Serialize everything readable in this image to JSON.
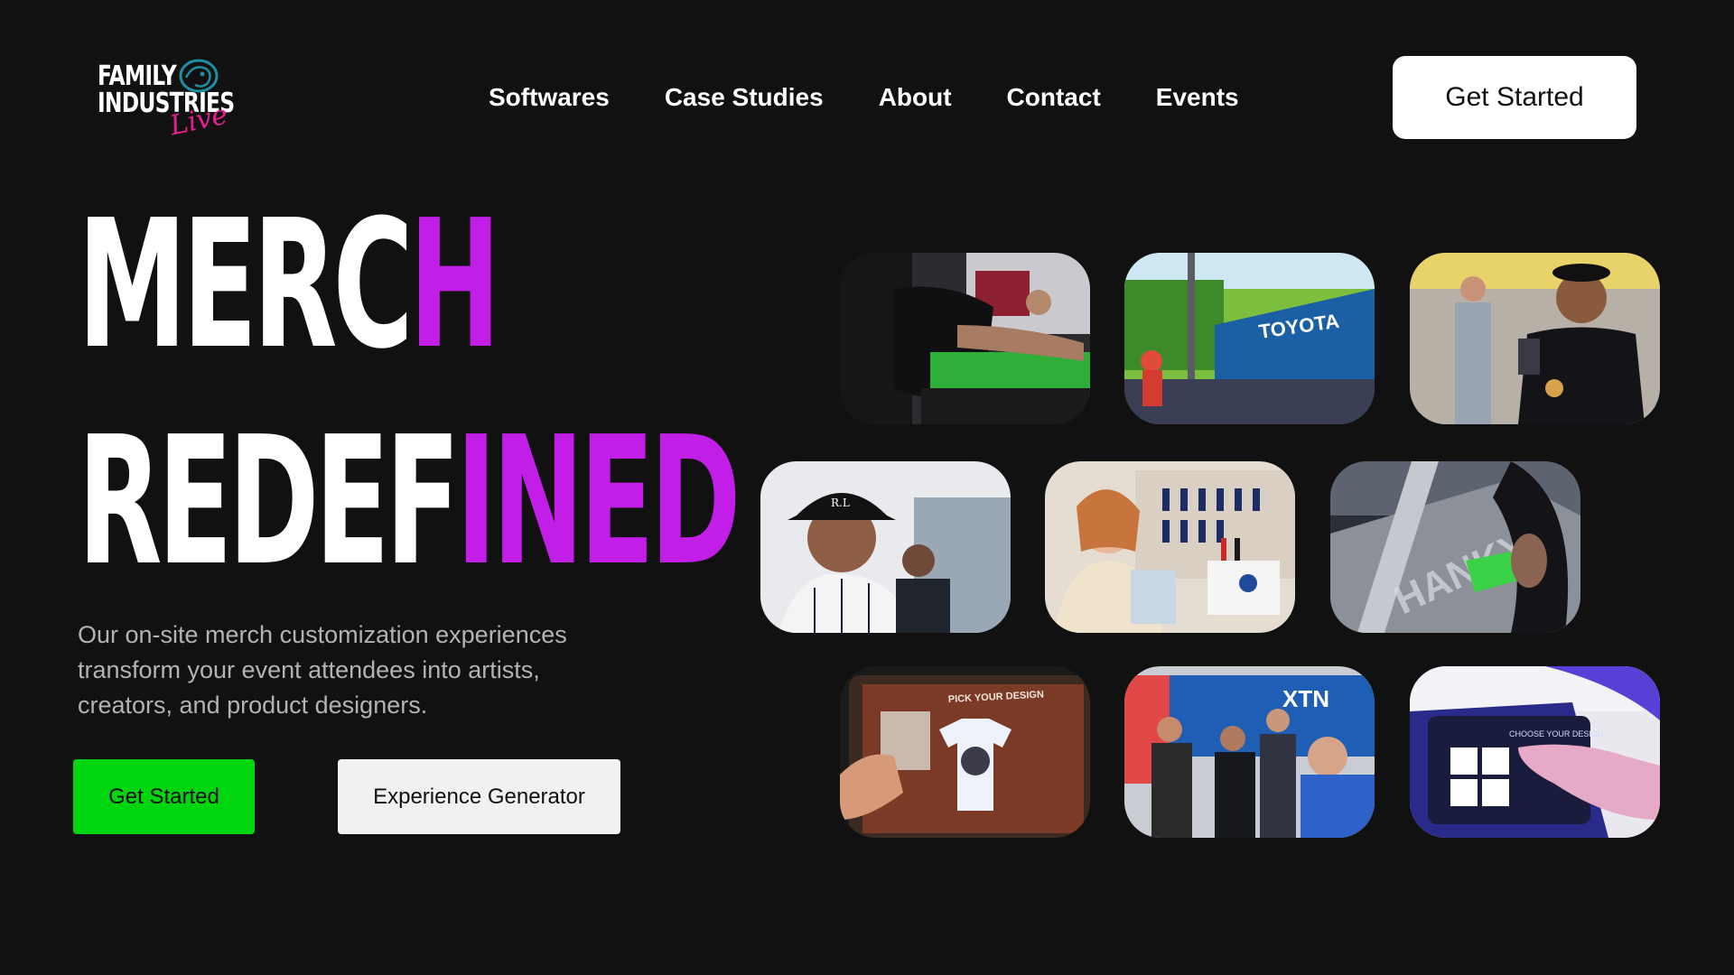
{
  "header": {
    "logo": {
      "line1": "FAMILY",
      "line2": "INDUSTRIES",
      "script": "Live"
    },
    "nav": [
      "Softwares",
      "Case Studies",
      "About",
      "Contact",
      "Events"
    ],
    "cta_label": "Get Started"
  },
  "hero": {
    "headline_line1_white": "MERC",
    "headline_line1_purple": "H",
    "headline_line2_white": "REDEF",
    "headline_line2_purple": "INED",
    "description": "Our on-site merch customization experiences transform your event attendees into artists, creators, and product designers.",
    "primary_cta": "Get Started",
    "secondary_cta": "Experience Generator"
  },
  "gallery": {
    "photos": [
      {
        "subject": "tattooed-arm-at-merch-station"
      },
      {
        "subject": "toyota-festival-lineup-stage",
        "overlay_text": "TOYOTA"
      },
      {
        "subject": "smiling-man-with-phone"
      },
      {
        "subject": "man-in-bucket-hat"
      },
      {
        "subject": "woman-at-embroidery-station"
      },
      {
        "subject": "laser-etching-machine",
        "overlay_text": "HANKY"
      },
      {
        "subject": "tablet-pick-your-design",
        "overlay_text": "PICK YOUR DESIGN"
      },
      {
        "subject": "trade-show-crowd",
        "overlay_text": "XTN"
      },
      {
        "subject": "tablet-choose-your-design",
        "overlay_text": "CHOOSE YOUR DESIGN"
      }
    ]
  },
  "colors": {
    "background": "#111111",
    "accent_purple": "#c21ee8",
    "cta_green": "#00d60f",
    "logo_pink": "#e61f8f"
  }
}
